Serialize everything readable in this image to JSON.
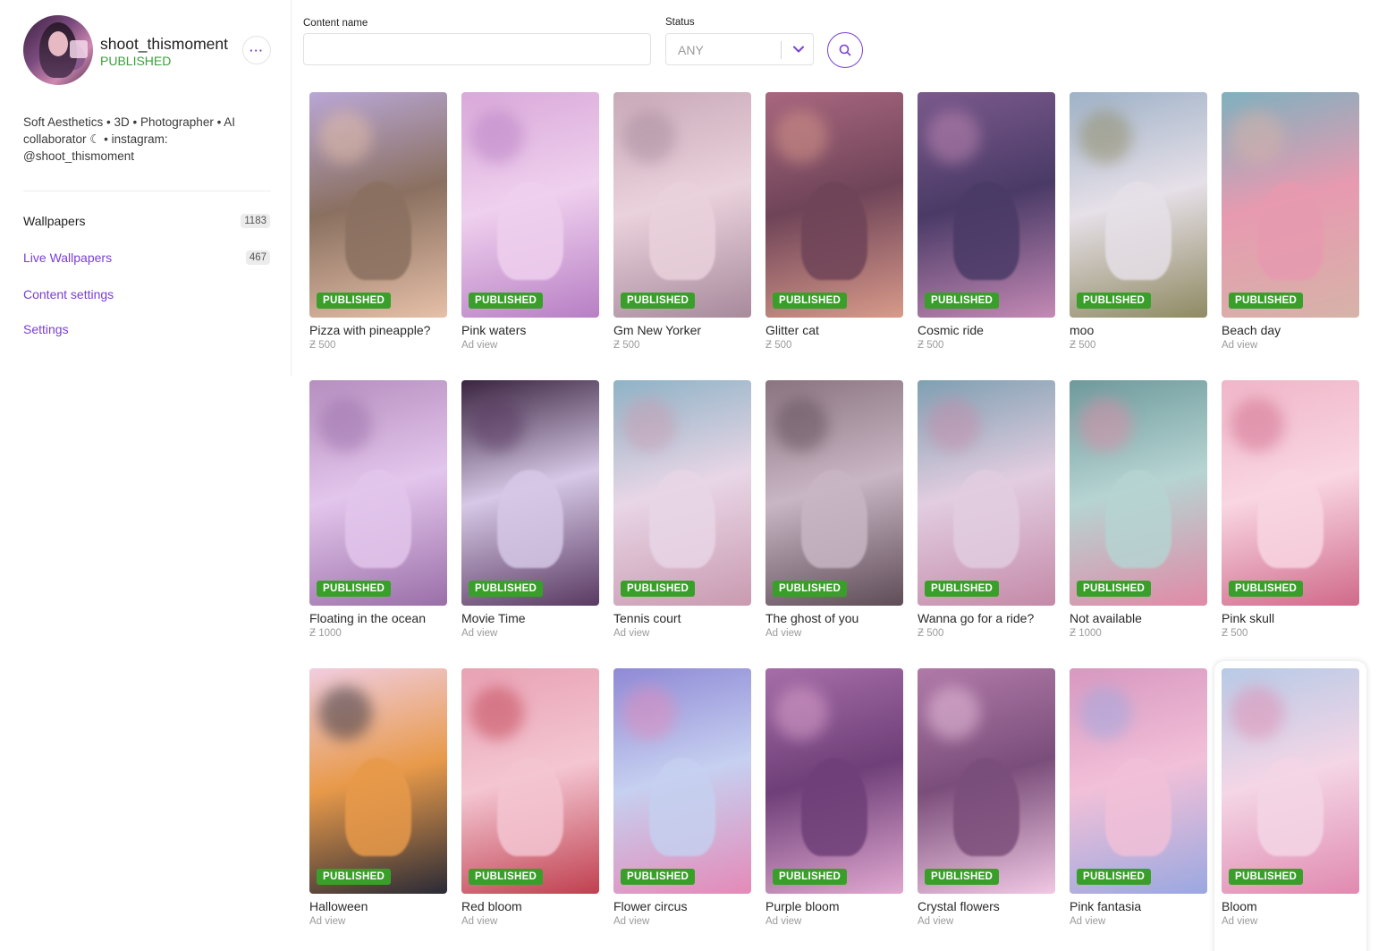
{
  "profile": {
    "username": "shoot_thismoment",
    "status": "PUBLISHED",
    "more_label": "···",
    "bio": "Soft Aesthetics • 3D • Photographer • AI collaborator ☾ • instagram: @shoot_thismoment"
  },
  "nav": [
    {
      "label": "Wallpapers",
      "count": "1183",
      "active": true
    },
    {
      "label": "Live Wallpapers",
      "count": "467",
      "active": false
    },
    {
      "label": "Content settings",
      "count": "",
      "active": false
    },
    {
      "label": "Settings",
      "count": "",
      "active": false
    }
  ],
  "filters": {
    "content_name_label": "Content name",
    "content_name_value": "",
    "status_label": "Status",
    "status_value": "ANY"
  },
  "colors": {
    "accent": "#7a3fd0",
    "published": "#3a9f2a",
    "status_text": "#3aa13a"
  },
  "items": [
    {
      "title": "Pizza with pineapple?",
      "meta": "Ƶ 500",
      "badge": "PUBLISHED",
      "c1": "#b9a7d6",
      "c2": "#e6c0a8",
      "c3": "#8a7060"
    },
    {
      "title": "Pink waters",
      "meta": "Ad view",
      "badge": "PUBLISHED",
      "c1": "#d9a9d9",
      "c2": "#b77fc4",
      "c3": "#efd0ee"
    },
    {
      "title": "Gm New Yorker",
      "meta": "Ƶ 500",
      "badge": "PUBLISHED",
      "c1": "#c9aab8",
      "c2": "#a78a9c",
      "c3": "#ead2dc"
    },
    {
      "title": "Glitter cat",
      "meta": "Ƶ 500",
      "badge": "PUBLISHED",
      "c1": "#a8677f",
      "c2": "#d89a8a",
      "c3": "#6f4458"
    },
    {
      "title": "Cosmic ride",
      "meta": "Ƶ 500",
      "badge": "PUBLISHED",
      "c1": "#7a5a8c",
      "c2": "#c48ab5",
      "c3": "#4a3a66"
    },
    {
      "title": "moo",
      "meta": "Ƶ 500",
      "badge": "PUBLISHED",
      "c1": "#9fb2c8",
      "c2": "#8f8a62",
      "c3": "#e6e0e8"
    },
    {
      "title": "Beach day",
      "meta": "Ad view",
      "badge": "PUBLISHED",
      "c1": "#7fb1bf",
      "c2": "#d6b3a8",
      "c3": "#e79ab0"
    },
    {
      "title": "Floating in the ocean",
      "meta": "Ƶ 1000",
      "badge": "PUBLISHED",
      "c1": "#b68fbf",
      "c2": "#9a6fa8",
      "c3": "#e3c6ec"
    },
    {
      "title": "Movie Time",
      "meta": "Ad view",
      "badge": "PUBLISHED",
      "c1": "#3a2440",
      "c2": "#5a3a62",
      "c3": "#d6c8e6"
    },
    {
      "title": "Tennis court",
      "meta": "Ad view",
      "badge": "PUBLISHED",
      "c1": "#8fb3c6",
      "c2": "#c99ab0",
      "c3": "#e8d6e6"
    },
    {
      "title": "The ghost of you",
      "meta": "Ad view",
      "badge": "PUBLISHED",
      "c1": "#8a7480",
      "c2": "#5e4c57",
      "c3": "#c9b6c4"
    },
    {
      "title": "Wanna go for a ride?",
      "meta": "Ƶ 500",
      "badge": "PUBLISHED",
      "c1": "#7fa0b2",
      "c2": "#c48aa8",
      "c3": "#e2cde0"
    },
    {
      "title": "Not available",
      "meta": "Ƶ 1000",
      "badge": "PUBLISHED",
      "c1": "#6e9a9c",
      "c2": "#e08aa6",
      "c3": "#b6d4d2"
    },
    {
      "title": "Pink skull",
      "meta": "Ƶ 500",
      "badge": "PUBLISHED",
      "c1": "#f0b6c8",
      "c2": "#d06a8a",
      "c3": "#f9d6e2"
    },
    {
      "title": "Halloween",
      "meta": "Ad view",
      "badge": "PUBLISHED",
      "c1": "#f0cde0",
      "c2": "#2a2a36",
      "c3": "#e89a4a"
    },
    {
      "title": "Red bloom",
      "meta": "Ad view",
      "badge": "PUBLISHED",
      "c1": "#e8a2b4",
      "c2": "#c0404f",
      "c3": "#f4c6d2"
    },
    {
      "title": "Flower circus",
      "meta": "Ad view",
      "badge": "PUBLISHED",
      "c1": "#8f8ad6",
      "c2": "#e48ab8",
      "c3": "#c6d0f0"
    },
    {
      "title": "Purple bloom",
      "meta": "Ad view",
      "badge": "PUBLISHED",
      "c1": "#a66ea8",
      "c2": "#e0a8d0",
      "c3": "#6e3f78"
    },
    {
      "title": "Crystal flowers",
      "meta": "Ad view",
      "badge": "PUBLISHED",
      "c1": "#b07aa8",
      "c2": "#f0c8e4",
      "c3": "#7a4e7a"
    },
    {
      "title": "Pink fantasia",
      "meta": "Ad view",
      "badge": "PUBLISHED",
      "c1": "#d898c0",
      "c2": "#9aa8e0",
      "c3": "#f2c0d8"
    },
    {
      "title": "Bloom",
      "meta": "Ad view",
      "badge": "PUBLISHED",
      "c1": "#b8cae6",
      "c2": "#e08ab0",
      "c3": "#f4d6e6"
    }
  ]
}
